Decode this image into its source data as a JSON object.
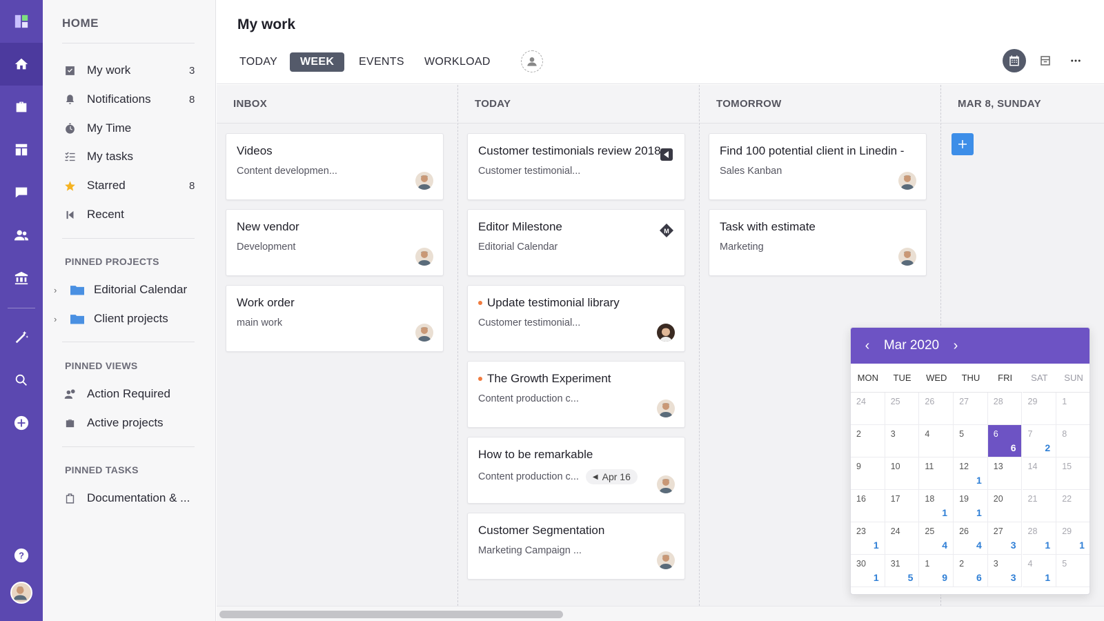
{
  "sidebar": {
    "home_label": "HOME",
    "items": [
      {
        "label": "My work",
        "count": "3",
        "icon": "checkbox-icon"
      },
      {
        "label": "Notifications",
        "count": "8",
        "icon": "bell-icon"
      },
      {
        "label": "My Time",
        "count": "",
        "icon": "stopwatch-icon"
      },
      {
        "label": "My tasks",
        "count": "",
        "icon": "task-list-icon"
      },
      {
        "label": "Starred",
        "count": "8",
        "icon": "star-icon"
      },
      {
        "label": "Recent",
        "count": "",
        "icon": "recent-icon"
      }
    ],
    "pinned_projects_label": "PINNED PROJECTS",
    "pinned_projects": [
      "Editorial Calendar",
      "Client projects"
    ],
    "pinned_views_label": "PINNED VIEWS",
    "pinned_views": [
      "Action Required",
      "Active projects"
    ],
    "pinned_tasks_label": "PINNED TASKS",
    "pinned_tasks": [
      "Documentation & ..."
    ]
  },
  "header": {
    "title": "My work",
    "tabs": [
      "TODAY",
      "WEEK",
      "EVENTS",
      "WORKLOAD"
    ],
    "active_tab": "WEEK"
  },
  "columns": [
    {
      "title": "INBOX",
      "cards": [
        {
          "title": "Videos",
          "subtitle": "Content developmen..."
        },
        {
          "title": "New vendor",
          "subtitle": "Development"
        },
        {
          "title": "Work order",
          "subtitle": "main work"
        }
      ]
    },
    {
      "title": "TODAY",
      "cards": [
        {
          "title": "Customer testimonials review 2018",
          "subtitle": "Customer testimonial..."
        },
        {
          "title": "Editor Milestone",
          "subtitle": "Editorial Calendar"
        },
        {
          "title": "Update testimonial library",
          "subtitle": "Customer testimonial..."
        },
        {
          "title": "The Growth Experiment",
          "subtitle": "Content production c..."
        },
        {
          "title": "How to be remarkable",
          "subtitle": "Content production c...",
          "due": "Apr 16"
        },
        {
          "title": "Customer Segmentation",
          "subtitle": "Marketing Campaign ..."
        }
      ]
    },
    {
      "title": "TOMORROW",
      "cards": [
        {
          "title": "Find 100 potential client in Linedin -",
          "subtitle": "Sales Kanban"
        },
        {
          "title": "Task with estimate",
          "subtitle": "Marketing"
        }
      ]
    },
    {
      "title": "MAR 8, SUNDAY",
      "cards": []
    }
  ],
  "calendar": {
    "month": "Mar 2020",
    "weekdays": [
      "MON",
      "TUE",
      "WED",
      "THU",
      "FRI",
      "SAT",
      "SUN"
    ],
    "weeks": [
      [
        {
          "d": "24",
          "dim": true
        },
        {
          "d": "25",
          "dim": true
        },
        {
          "d": "26",
          "dim": true
        },
        {
          "d": "27",
          "dim": true
        },
        {
          "d": "28",
          "dim": true
        },
        {
          "d": "29",
          "dim": true
        },
        {
          "d": "1"
        }
      ],
      [
        {
          "d": "2"
        },
        {
          "d": "3"
        },
        {
          "d": "4"
        },
        {
          "d": "5"
        },
        {
          "d": "6",
          "n": "6",
          "sel": true
        },
        {
          "d": "7",
          "n": "2"
        },
        {
          "d": "8"
        }
      ],
      [
        {
          "d": "9"
        },
        {
          "d": "10"
        },
        {
          "d": "11"
        },
        {
          "d": "12",
          "n": "1"
        },
        {
          "d": "13"
        },
        {
          "d": "14"
        },
        {
          "d": "15"
        }
      ],
      [
        {
          "d": "16"
        },
        {
          "d": "17"
        },
        {
          "d": "18",
          "n": "1"
        },
        {
          "d": "19",
          "n": "1"
        },
        {
          "d": "20"
        },
        {
          "d": "21"
        },
        {
          "d": "22"
        }
      ],
      [
        {
          "d": "23",
          "n": "1"
        },
        {
          "d": "24"
        },
        {
          "d": "25",
          "n": "4"
        },
        {
          "d": "26",
          "n": "4"
        },
        {
          "d": "27",
          "n": "3"
        },
        {
          "d": "28",
          "n": "1"
        },
        {
          "d": "29",
          "n": "1"
        }
      ],
      [
        {
          "d": "30",
          "n": "1"
        },
        {
          "d": "31",
          "n": "5"
        },
        {
          "d": "1",
          "n": "9"
        },
        {
          "d": "2",
          "n": "6"
        },
        {
          "d": "3",
          "n": "3"
        },
        {
          "d": "4",
          "n": "1"
        },
        {
          "d": "5"
        }
      ]
    ]
  },
  "colors": {
    "rail": "#5b48b0",
    "accent": "#6d53c4",
    "tab_active": "#545a6a",
    "add_button": "#3d8ee8"
  }
}
